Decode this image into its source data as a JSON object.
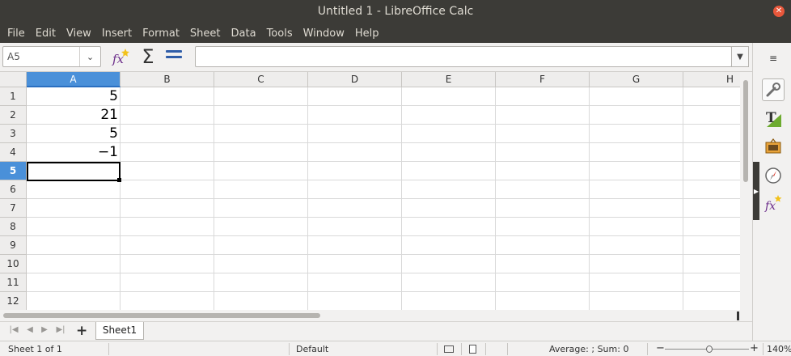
{
  "window": {
    "title": "Untitled 1 - LibreOffice Calc"
  },
  "menu": [
    "File",
    "Edit",
    "View",
    "Insert",
    "Format",
    "Sheet",
    "Data",
    "Tools",
    "Window",
    "Help"
  ],
  "formula_bar": {
    "name_box": "A5",
    "formula": "",
    "icons": [
      "function-wizard-icon",
      "sum-icon",
      "formula-icon",
      "expand-icon"
    ]
  },
  "columns": [
    "A",
    "B",
    "C",
    "D",
    "E",
    "F",
    "G",
    "H"
  ],
  "rows": [
    "1",
    "2",
    "3",
    "4",
    "5",
    "6",
    "7",
    "8",
    "9",
    "10",
    "11",
    "12"
  ],
  "cells": {
    "A1": "5",
    "A2": "21",
    "A3": "5",
    "A4": "−1"
  },
  "selected": {
    "column": "A",
    "row": "5"
  },
  "tabs": {
    "sheets": [
      "Sheet1"
    ],
    "active": "Sheet1"
  },
  "status": {
    "sheet": "Sheet 1 of 1",
    "page_style": "Default",
    "stats": "Average: ; Sum: 0",
    "zoom": "140%"
  },
  "sidebar": {
    "icons": [
      "properties-icon",
      "styles-icon",
      "gallery-icon",
      "navigator-icon",
      "functions-icon"
    ],
    "accent": "#4a90d9"
  }
}
